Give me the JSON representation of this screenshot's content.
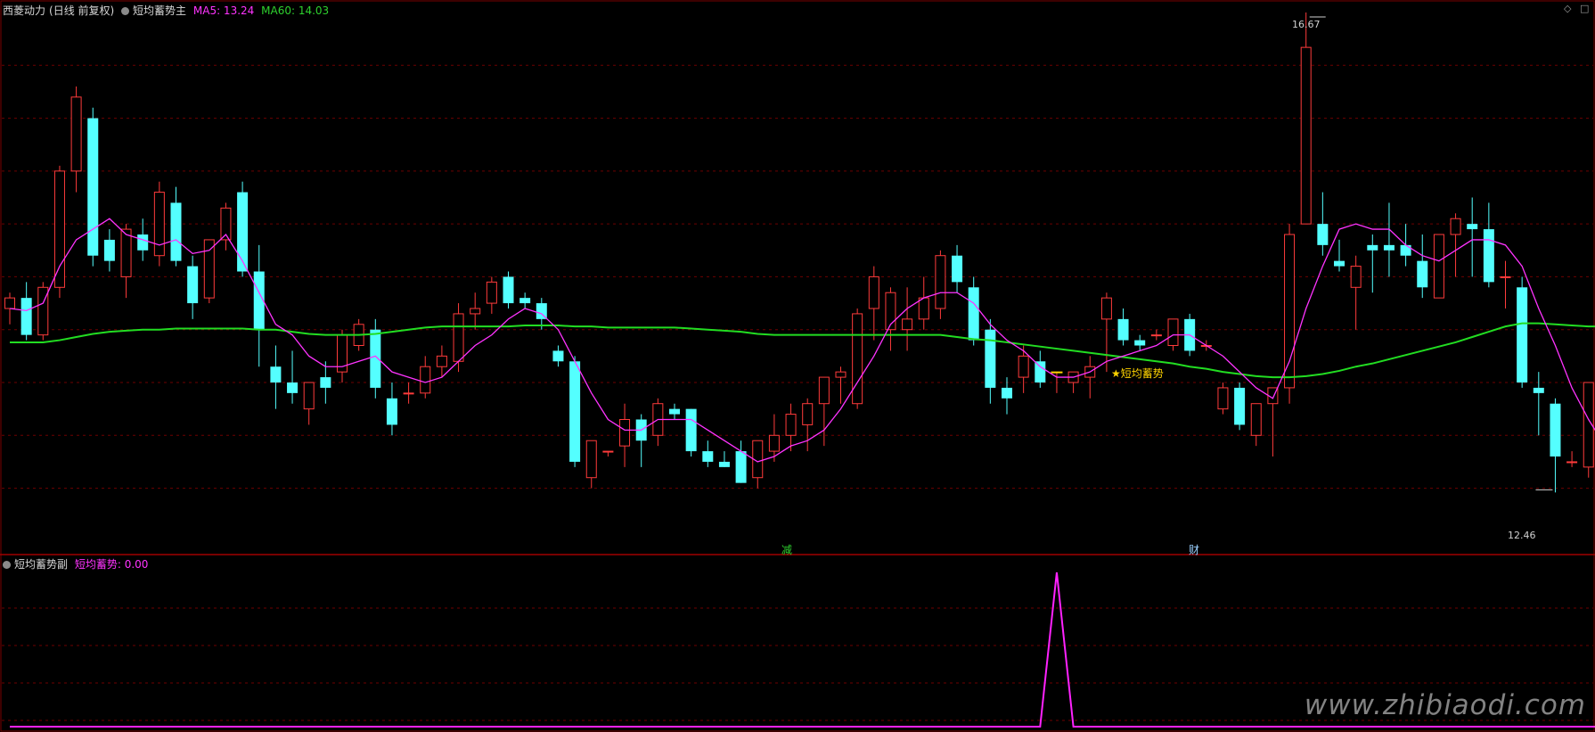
{
  "header": {
    "stock_name": "西菱动力",
    "period": "(日线 前复权)",
    "indicator_main": "短均蓄势主",
    "ma5_label": "MA5: 13.24",
    "ma60_label": "MA60: 14.03"
  },
  "sub_header": {
    "indicator_sub": "短均蓄势副",
    "value_label": "短均蓄势: 0.00"
  },
  "markers": {
    "signal_label": "★短均蓄势",
    "high_label": "16.67",
    "low_label": "12.46",
    "event1": "减",
    "event2": "财"
  },
  "watermark": "www.zhibiaodi.com",
  "colors": {
    "up": "#ff3b3b",
    "down": "#54ffff",
    "ma5": "#ff33ff",
    "ma60": "#22dd22",
    "grid": "#6e0000",
    "signal": "#ffd400",
    "sub_line": "#ff22ff"
  },
  "chart_data": [
    {
      "type": "candlestick",
      "ylim": [
        12.1,
        17.0
      ],
      "grid": true,
      "ohlc": [
        [
          14.2,
          14.35,
          14.05,
          14.3
        ],
        [
          14.3,
          14.45,
          13.9,
          13.95
        ],
        [
          13.95,
          14.45,
          13.9,
          14.4
        ],
        [
          14.4,
          15.55,
          14.3,
          15.5
        ],
        [
          15.5,
          16.3,
          15.3,
          16.2
        ],
        [
          16.0,
          16.1,
          14.6,
          14.7
        ],
        [
          14.85,
          14.95,
          14.55,
          14.65
        ],
        [
          14.5,
          15.0,
          14.3,
          14.95
        ],
        [
          14.9,
          15.05,
          14.65,
          14.75
        ],
        [
          14.7,
          15.4,
          14.6,
          15.3
        ],
        [
          15.2,
          15.35,
          14.6,
          14.65
        ],
        [
          14.6,
          14.7,
          14.1,
          14.25
        ],
        [
          14.3,
          14.85,
          14.25,
          14.85
        ],
        [
          14.85,
          15.2,
          14.75,
          15.15
        ],
        [
          15.3,
          15.4,
          14.5,
          14.55
        ],
        [
          14.55,
          14.8,
          13.65,
          14.0
        ],
        [
          13.65,
          13.85,
          13.25,
          13.5
        ],
        [
          13.5,
          13.8,
          13.3,
          13.4
        ],
        [
          13.25,
          13.5,
          13.1,
          13.5
        ],
        [
          13.55,
          13.7,
          13.3,
          13.45
        ],
        [
          13.6,
          14.0,
          13.5,
          13.95
        ],
        [
          13.85,
          14.1,
          13.8,
          14.05
        ],
        [
          14.0,
          14.1,
          13.35,
          13.45
        ],
        [
          13.35,
          13.5,
          13.0,
          13.1
        ],
        [
          13.4,
          13.5,
          13.3,
          13.4
        ],
        [
          13.4,
          13.75,
          13.35,
          13.65
        ],
        [
          13.65,
          13.85,
          13.55,
          13.75
        ],
        [
          13.7,
          14.25,
          13.6,
          14.15
        ],
        [
          14.15,
          14.35,
          14.0,
          14.2
        ],
        [
          14.25,
          14.5,
          14.15,
          14.45
        ],
        [
          14.5,
          14.55,
          14.2,
          14.25
        ],
        [
          14.3,
          14.35,
          14.2,
          14.25
        ],
        [
          14.25,
          14.3,
          14.0,
          14.1
        ],
        [
          13.8,
          13.85,
          13.65,
          13.7
        ],
        [
          13.7,
          13.75,
          12.7,
          12.75
        ],
        [
          12.6,
          12.95,
          12.5,
          12.95
        ],
        [
          12.85,
          12.85,
          12.8,
          12.85
        ],
        [
          12.9,
          13.3,
          12.7,
          13.15
        ],
        [
          13.15,
          13.2,
          12.7,
          12.95
        ],
        [
          13.0,
          13.35,
          12.9,
          13.3
        ],
        [
          13.25,
          13.3,
          13.15,
          13.2
        ],
        [
          13.25,
          13.25,
          12.8,
          12.85
        ],
        [
          12.85,
          12.95,
          12.7,
          12.75
        ],
        [
          12.75,
          12.85,
          12.7,
          12.7
        ],
        [
          12.85,
          12.95,
          12.55,
          12.55
        ],
        [
          12.6,
          12.95,
          12.5,
          12.95
        ],
        [
          12.85,
          13.2,
          12.75,
          13.0
        ],
        [
          13.0,
          13.3,
          12.85,
          13.2
        ],
        [
          13.1,
          13.35,
          12.85,
          13.3
        ],
        [
          13.3,
          13.55,
          12.9,
          13.55
        ],
        [
          13.55,
          13.65,
          13.3,
          13.6
        ],
        [
          13.3,
          14.2,
          13.25,
          14.15
        ],
        [
          14.2,
          14.6,
          13.9,
          14.5
        ],
        [
          14.0,
          14.4,
          13.8,
          14.35
        ],
        [
          14.0,
          14.4,
          13.8,
          14.1
        ],
        [
          14.1,
          14.5,
          14.0,
          14.3
        ],
        [
          14.2,
          14.75,
          14.1,
          14.7
        ],
        [
          14.7,
          14.8,
          14.35,
          14.45
        ],
        [
          14.4,
          14.5,
          13.85,
          13.9
        ],
        [
          14.0,
          14.1,
          13.3,
          13.45
        ],
        [
          13.45,
          13.55,
          13.2,
          13.35
        ],
        [
          13.55,
          13.85,
          13.4,
          13.75
        ],
        [
          13.7,
          13.8,
          13.45,
          13.5
        ],
        [
          13.6,
          13.6,
          13.4,
          13.6
        ],
        [
          13.5,
          13.6,
          13.4,
          13.6
        ],
        [
          13.55,
          13.75,
          13.35,
          13.65
        ],
        [
          14.1,
          14.35,
          13.6,
          14.3
        ],
        [
          14.1,
          14.2,
          13.85,
          13.9
        ],
        [
          13.9,
          13.95,
          13.8,
          13.85
        ],
        [
          13.95,
          14.0,
          13.9,
          13.95
        ],
        [
          13.85,
          14.1,
          13.8,
          14.1
        ],
        [
          14.1,
          14.15,
          13.75,
          13.8
        ],
        [
          13.85,
          13.9,
          13.8,
          13.85
        ],
        [
          13.25,
          13.5,
          13.2,
          13.45
        ],
        [
          13.45,
          13.5,
          13.05,
          13.1
        ],
        [
          13.0,
          13.3,
          12.9,
          13.3
        ],
        [
          13.3,
          13.4,
          12.8,
          13.45
        ],
        [
          13.45,
          15.0,
          13.3,
          14.9
        ],
        [
          15.0,
          17.0,
          15.0,
          16.67
        ],
        [
          15.0,
          15.3,
          14.7,
          14.8
        ],
        [
          14.65,
          14.85,
          14.55,
          14.6
        ],
        [
          14.4,
          14.7,
          14.0,
          14.6
        ],
        [
          14.8,
          14.9,
          14.35,
          14.75
        ],
        [
          14.8,
          15.2,
          14.5,
          14.75
        ],
        [
          14.8,
          15.0,
          14.6,
          14.7
        ],
        [
          14.65,
          14.9,
          14.3,
          14.4
        ],
        [
          14.3,
          14.9,
          14.3,
          14.9
        ],
        [
          14.9,
          15.1,
          14.5,
          15.05
        ],
        [
          15.0,
          15.25,
          14.5,
          14.95
        ],
        [
          14.95,
          15.2,
          14.4,
          14.45
        ],
        [
          14.5,
          14.65,
          14.2,
          14.5
        ],
        [
          14.4,
          14.5,
          13.45,
          13.5
        ],
        [
          13.45,
          13.6,
          13.0,
          13.4
        ],
        [
          13.3,
          13.35,
          12.46,
          12.8
        ],
        [
          12.75,
          12.85,
          12.7,
          12.75
        ],
        [
          12.7,
          13.5,
          12.6,
          13.5
        ],
        [
          13.5,
          13.5,
          13.1,
          13.15
        ]
      ],
      "ma5": [
        14.2,
        14.18,
        14.25,
        14.6,
        14.85,
        14.95,
        15.05,
        14.9,
        14.85,
        14.8,
        14.85,
        14.72,
        14.75,
        14.9,
        14.65,
        14.35,
        14.05,
        13.95,
        13.75,
        13.65,
        13.65,
        13.7,
        13.75,
        13.6,
        13.55,
        13.5,
        13.55,
        13.7,
        13.85,
        13.95,
        14.1,
        14.2,
        14.15,
        14.0,
        13.7,
        13.4,
        13.15,
        13.05,
        13.05,
        13.15,
        13.15,
        13.15,
        13.05,
        12.95,
        12.85,
        12.75,
        12.8,
        12.9,
        12.95,
        13.05,
        13.25,
        13.5,
        13.75,
        14.05,
        14.2,
        14.3,
        14.35,
        14.35,
        14.25,
        14.05,
        13.9,
        13.8,
        13.65,
        13.55,
        13.55,
        13.6,
        13.7,
        13.75,
        13.8,
        13.85,
        13.95,
        13.95,
        13.85,
        13.75,
        13.6,
        13.45,
        13.35,
        13.7,
        14.2,
        14.6,
        14.95,
        15.0,
        14.95,
        14.95,
        14.8,
        14.7,
        14.65,
        14.75,
        14.85,
        14.85,
        14.8,
        14.6,
        14.2,
        13.85,
        13.45,
        13.15,
        12.9
      ],
      "ma60": [
        13.88,
        13.88,
        13.88,
        13.9,
        13.93,
        13.96,
        13.98,
        13.99,
        14.0,
        14.0,
        14.01,
        14.01,
        14.01,
        14.01,
        14.01,
        14.0,
        14.0,
        13.98,
        13.96,
        13.95,
        13.95,
        13.95,
        13.96,
        13.98,
        14.0,
        14.02,
        14.03,
        14.03,
        14.03,
        14.03,
        14.03,
        14.04,
        14.04,
        14.04,
        14.03,
        14.03,
        14.02,
        14.02,
        14.02,
        14.02,
        14.02,
        14.01,
        14.0,
        13.99,
        13.98,
        13.96,
        13.95,
        13.95,
        13.95,
        13.95,
        13.95,
        13.95,
        13.95,
        13.95,
        13.95,
        13.95,
        13.95,
        13.93,
        13.91,
        13.9,
        13.88,
        13.86,
        13.84,
        13.82,
        13.8,
        13.78,
        13.76,
        13.74,
        13.72,
        13.7,
        13.68,
        13.65,
        13.63,
        13.6,
        13.58,
        13.56,
        13.55,
        13.55,
        13.56,
        13.58,
        13.61,
        13.65,
        13.68,
        13.72,
        13.76,
        13.8,
        13.84,
        13.88,
        13.93,
        13.98,
        14.03,
        14.06,
        14.06,
        14.05,
        14.04,
        14.03,
        14.03
      ],
      "signal_index": 63
    },
    {
      "type": "line",
      "ylim": [
        0,
        1
      ],
      "values_nonzero": [
        {
          "index": 63,
          "value": 1
        }
      ],
      "length": 97
    }
  ]
}
